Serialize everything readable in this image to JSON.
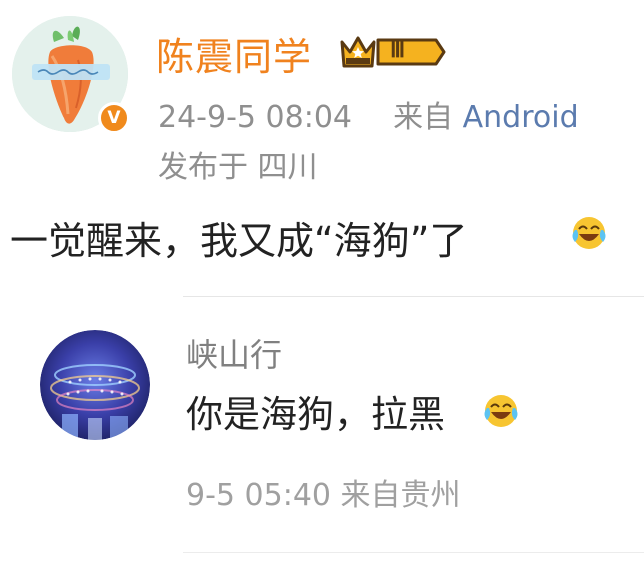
{
  "post": {
    "author": {
      "name": "陈震同学",
      "verified_badge": "V",
      "level_badge": "Ⅲ"
    },
    "meta": {
      "timestamp": "24-9-5 08:04",
      "source_prefix": "来自",
      "source": "Android",
      "location": "发布于 四川"
    },
    "content": "一觉醒来，我又成“海狗”了",
    "content_emoji": "laughing-crying-emoji-icon"
  },
  "reply": {
    "author": {
      "name": "峡山行"
    },
    "content": "你是海狗，拉黑",
    "content_emoji": "laughing-crying-emoji-icon",
    "meta": "9-5 05:40  来自贵州"
  },
  "colors": {
    "username": "#f0821e",
    "verified": "#f08a1c",
    "link": "#5b7bae",
    "meta": "#8f8f8f",
    "text": "#222222"
  }
}
